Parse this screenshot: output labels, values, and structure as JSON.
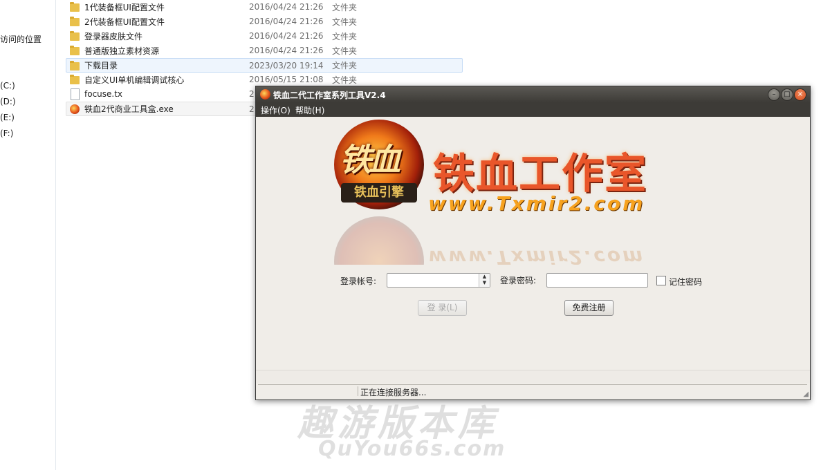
{
  "nav": {
    "recent": "访问的位置",
    "drives": [
      "(C:)",
      "(D:)",
      "(E:)",
      "(F:)"
    ]
  },
  "files": [
    {
      "name": "1代装备框UI配置文件",
      "date": "2016/04/24 21:26",
      "type": "文件夹",
      "icon": "folder-icon"
    },
    {
      "name": "2代装备框UI配置文件",
      "date": "2016/04/24 21:26",
      "type": "文件夹",
      "icon": "folder-icon"
    },
    {
      "name": "登录器皮肤文件",
      "date": "2016/04/24 21:26",
      "type": "文件夹",
      "icon": "folder-icon"
    },
    {
      "name": "普通版独立素材资源",
      "date": "2016/04/24 21:26",
      "type": "文件夹",
      "icon": "folder-icon"
    },
    {
      "name": "下载目录",
      "date": "2023/03/20 19:14",
      "type": "文件夹",
      "icon": "folder-icon"
    },
    {
      "name": "自定义UI单机编辑调试核心",
      "date": "2016/05/15 21:08",
      "type": "文件夹",
      "icon": "folder-icon"
    },
    {
      "name": "focuse.tx",
      "date": "2",
      "type": "",
      "icon": "document-icon"
    },
    {
      "name": "铁血2代商业工具盒.exe",
      "date": "2",
      "type": "",
      "icon": "app-icon"
    }
  ],
  "app": {
    "title": "铁血二代工作室系列工具V2.4",
    "menu": [
      "操作(O)",
      "帮助(H)"
    ],
    "window_buttons": {
      "minimize": "–",
      "maximize": "□",
      "close": "×"
    },
    "logo": {
      "emblem_text": "铁血",
      "emblem_sub": "铁血引擎",
      "brand_title": "铁血工作室",
      "brand_url": "www.Txmir2.com"
    },
    "form": {
      "account_label": "登录帐号:",
      "account_value": "",
      "password_label": "登录密码:",
      "password_value": "",
      "remember_label": "记住密码",
      "remember_checked": false,
      "login_button": "登 录(L)",
      "register_button": "免费注册"
    },
    "status": "正在连接服务器..."
  },
  "watermark": {
    "cn": "趣游版本库",
    "en": "QuYou66s.com"
  }
}
